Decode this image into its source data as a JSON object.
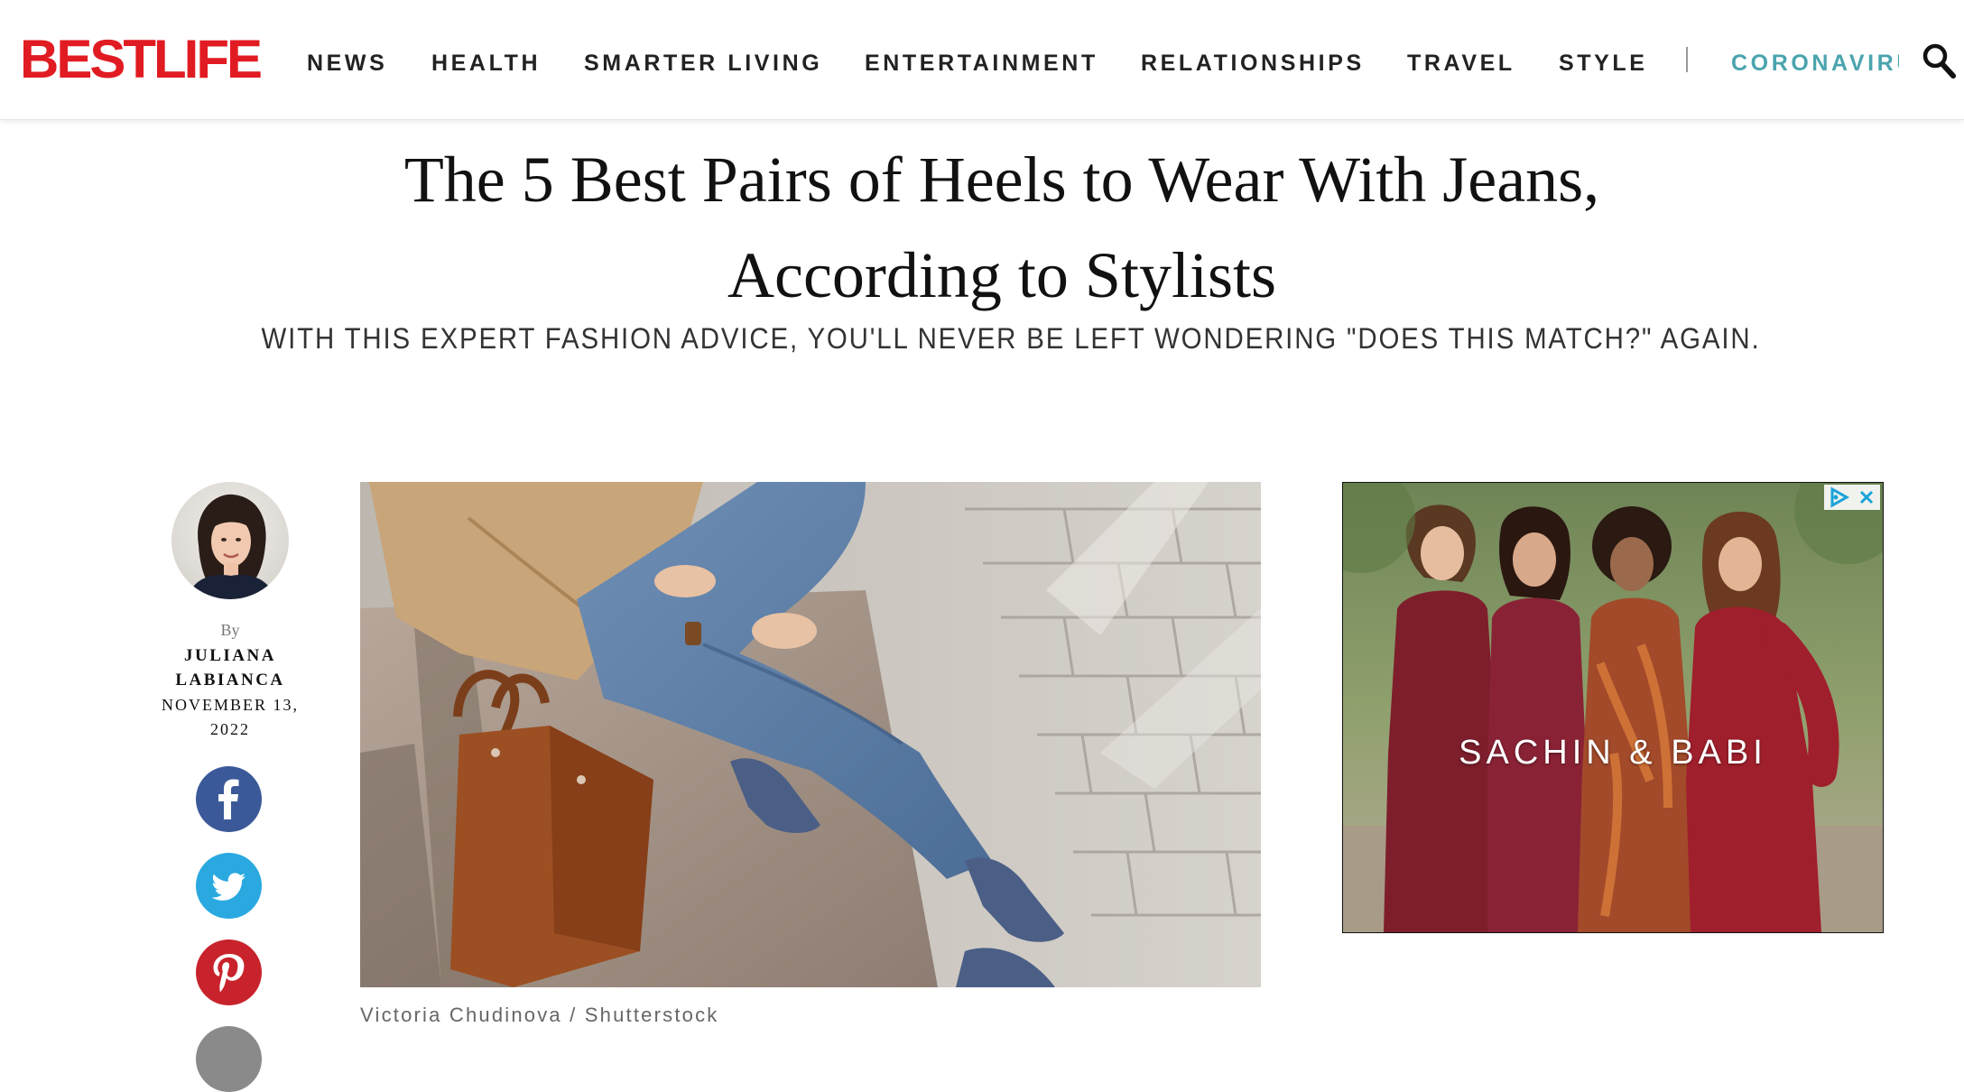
{
  "header": {
    "logo": "BESTLIFE",
    "nav": [
      {
        "label": "NEWS"
      },
      {
        "label": "HEALTH"
      },
      {
        "label": "SMARTER LIVING"
      },
      {
        "label": "ENTERTAINMENT"
      },
      {
        "label": "RELATIONSHIPS"
      },
      {
        "label": "TRAVEL"
      },
      {
        "label": "STYLE"
      }
    ],
    "highlight_nav": "CORONAVIRUS",
    "search_icon": "search-icon"
  },
  "article": {
    "title": "The 5 Best Pairs of Heels to Wear With Jeans, According to Stylists",
    "subtitle": "WITH THIS EXPERT FASHION ADVICE, YOU'LL NEVER BE LEFT WONDERING \"DOES THIS MATCH?\" AGAIN.",
    "byline_prefix": "By",
    "author": "JULIANA LABIANCA",
    "date": "NOVEMBER 13, 2022",
    "photo_credit": "Victoria Chudinova / Shutterstock"
  },
  "share": [
    {
      "network": "facebook",
      "icon": "facebook-icon",
      "color": "#3b5998"
    },
    {
      "network": "twitter",
      "icon": "twitter-icon",
      "color": "#2aa9e0"
    },
    {
      "network": "pinterest",
      "icon": "pinterest-icon",
      "color": "#c8232c"
    }
  ],
  "ad": {
    "brand": "SACHIN & BABI",
    "icons": [
      "adchoices-icon",
      "close-icon"
    ]
  },
  "colors": {
    "brand_red": "#e11b22",
    "highlight_teal": "#4aa4ae"
  }
}
